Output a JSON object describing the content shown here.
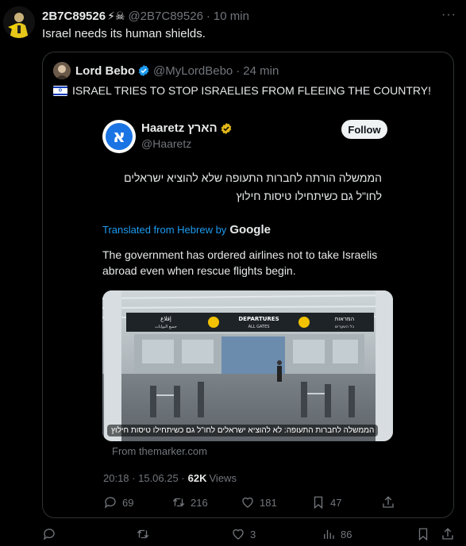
{
  "tweet": {
    "display_name": "2B7C89526",
    "name_emoji": "⚡☠",
    "handle": "@2B7C89526",
    "separator": "·",
    "time": "10 min",
    "text": "Israel needs its human shields.",
    "more": "···",
    "actions": {
      "reply_count": "",
      "retweet_count": "",
      "like_count": "3",
      "views_count": "86"
    }
  },
  "quote": {
    "display_name": "Lord Bebo",
    "handle": "@MyLordBebo",
    "separator": "·",
    "time": "24 min",
    "text": "ISRAEL TRIES TO STOP ISRAELIES FROM FLEEING THE COUNTRY!",
    "timestamp": "20:18 · 15.06.25 ·",
    "views_count": "62K",
    "views_label": "Views",
    "actions": {
      "reply_count": "69",
      "retweet_count": "216",
      "like_count": "181",
      "bookmark_count": "47"
    }
  },
  "embed": {
    "logo_letter": "א",
    "name": "Haaretz הארץ",
    "handle": "@Haaretz",
    "follow_label": "Follow",
    "hebrew_text": "הממשלה הורתה לחברות התעופה שלא להוציא ישראלים לחו\"ל גם כשיתחילו טיסות חילוץ",
    "translated_label": "Translated from Hebrew by",
    "google_label": "Google",
    "translated_text": "The government has ordered airlines not to take Israelis abroad even when rescue flights begin.",
    "photo_sign_left": "إقلاع",
    "photo_sign_left_sub": "جميع البوابات",
    "photo_sign_center": "DEPARTURES",
    "photo_sign_center_sub": "ALL GATES",
    "photo_sign_right": "המראות",
    "photo_sign_right_sub": "כל השערים",
    "photo_caption": "הממשלה לחברות התעופה: לא להוציא ישראלים לחו\"ל גם כשיתחילו טיסות חילוץ",
    "source": "From themarker.com"
  },
  "colors": {
    "background": "#000000",
    "text": "#e7e9ea",
    "muted": "#71767b",
    "link": "#1d9bf0",
    "border": "#2f3336",
    "verified": "#ffd400"
  }
}
